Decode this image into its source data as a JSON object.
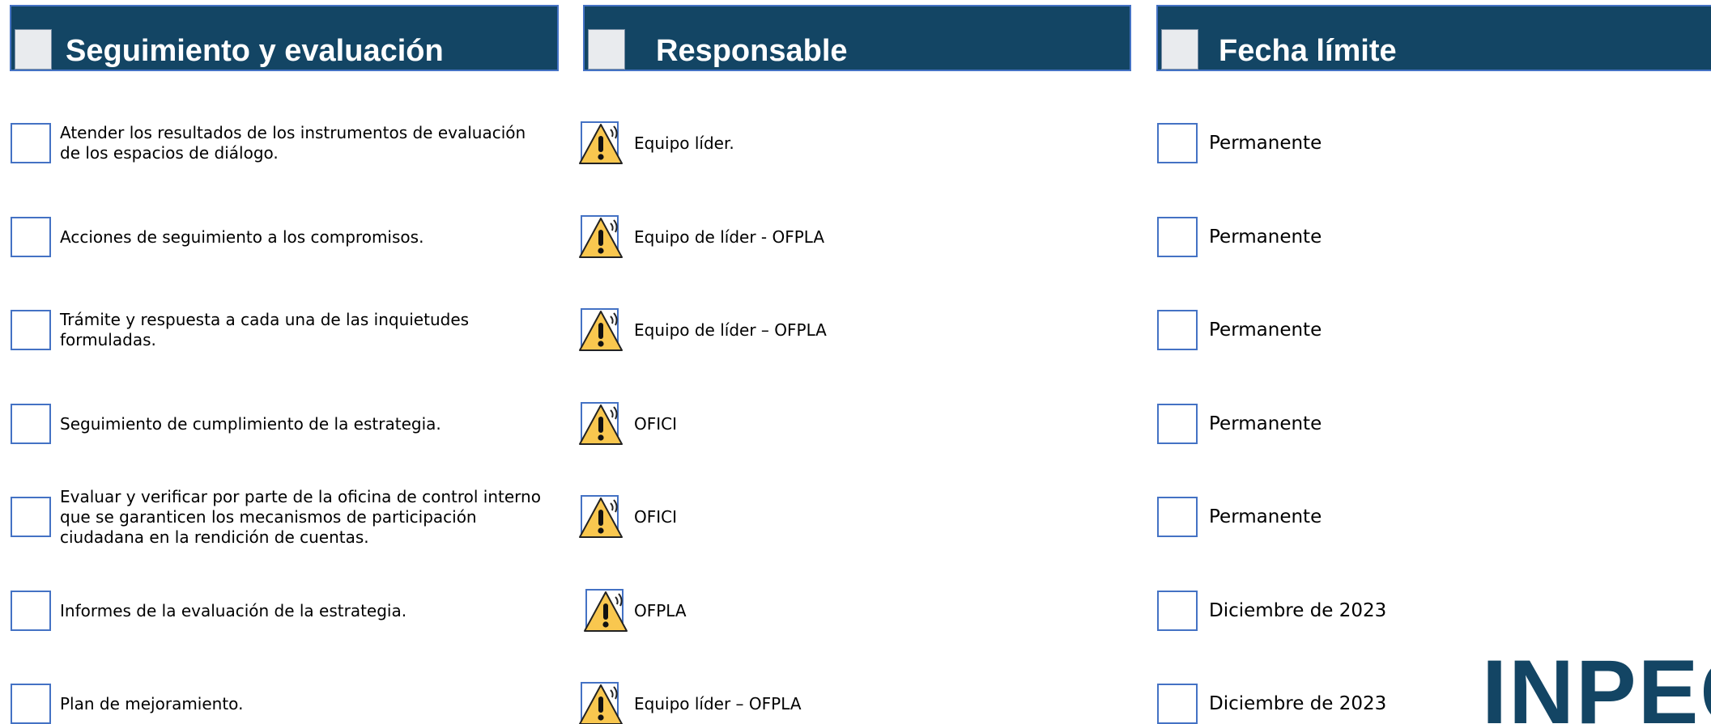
{
  "headers": {
    "tasks": "Seguimiento y evaluación",
    "responsible": "Responsable",
    "deadline": "Fecha límite"
  },
  "rows": [
    {
      "task": "Atender los resultados de los instrumentos de evaluación de los espacios de diálogo.",
      "responsible": "Equipo líder.",
      "deadline": "Permanente"
    },
    {
      "task": "Acciones de seguimiento a los compromisos.",
      "responsible": "Equipo de líder - OFPLA",
      "deadline": "Permanente"
    },
    {
      "task": "Trámite y respuesta a cada una de las inquietudes formuladas.",
      "responsible": "Equipo de líder – OFPLA",
      "deadline": "Permanente"
    },
    {
      "task": "Seguimiento de cumplimiento de la estrategia.",
      "responsible": "OFICI",
      "deadline": "Permanente"
    },
    {
      "task": "Evaluar y verificar por parte de la oficina de control interno que se garanticen los mecanismos de participación ciudadana en la rendición de cuentas.",
      "responsible": "OFICI",
      "deadline": "Permanente"
    },
    {
      "task": "Informes de la evaluación de la estrategia.",
      "responsible": "OFPLA",
      "deadline": "Diciembre de 2023"
    },
    {
      "task": "Plan de mejoramiento.",
      "responsible": "Equipo líder – OFPLA",
      "deadline": "Diciembre de 2023"
    }
  ],
  "logo": {
    "text": "INPEC",
    "color": "#134564"
  },
  "colors": {
    "header_bg": "#134564",
    "checkbox_border": "#4472C4",
    "warning_fill": "#F9C74F"
  }
}
